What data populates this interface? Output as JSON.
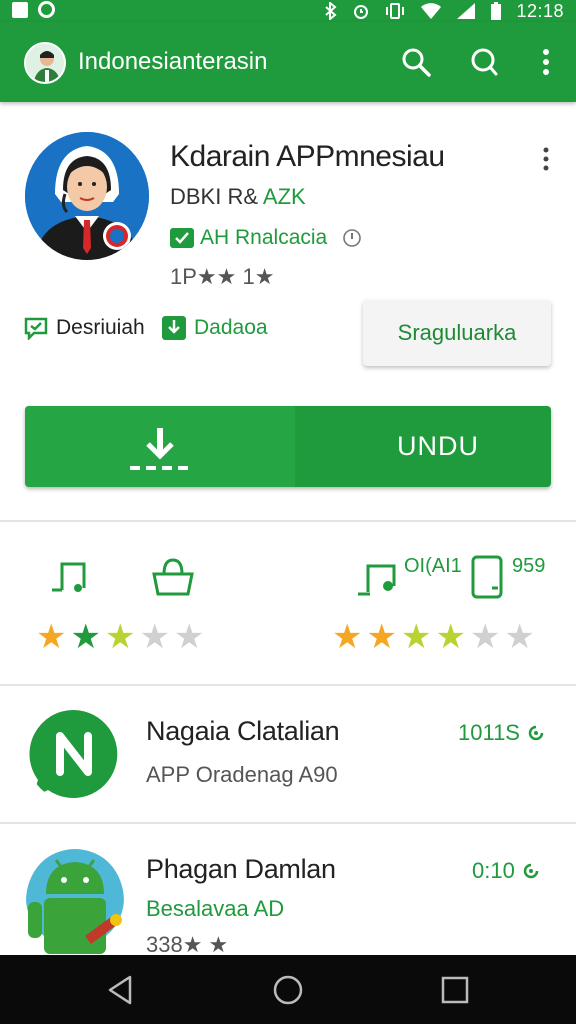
{
  "status_bar": {
    "left_icons": [
      "notification-icon",
      "whatsapp-icon"
    ],
    "right_icons": [
      "bluetooth-icon",
      "alarm-icon",
      "vibrate-icon",
      "wifi-icon",
      "signal-icon",
      "battery-icon"
    ],
    "time": "12:18"
  },
  "app_bar": {
    "title": "Indonesianterasin",
    "icons": [
      "search-icon",
      "chat-search-icon",
      "more-vert-icon"
    ]
  },
  "app": {
    "name": "Kdarain APPmnesiau",
    "developer_prefix": "DBKI R& ",
    "developer_suffix": "AZK",
    "badge": "AH Rnalcacia",
    "rating": "1P★★ 1★"
  },
  "tags": {
    "left": "Desriuiah",
    "right": "Dadaoa"
  },
  "buttons": {
    "secondary": "Sraguluarka",
    "install": "UNDU"
  },
  "stats": {
    "left_icons": [
      "music-note-icon",
      "bag-icon"
    ],
    "right_icons": [
      "music-device-icon",
      "phone-icon"
    ],
    "count_a": "OI(AI1",
    "count_b": "959",
    "left_stars": {
      "filled": 2,
      "half": 1,
      "total": 5
    },
    "right_stars": {
      "filled": 2,
      "half": 2,
      "total": 6
    }
  },
  "list": [
    {
      "title": "Nagaia Clatalian",
      "subtitle": "APP Oradenag A90",
      "size": "1011S"
    },
    {
      "title": "Phagan Damlan",
      "subtitle": "Besalavaa AD",
      "size": "0:10",
      "rating": "338★ ★"
    }
  ],
  "colors": {
    "primary": "#1f9a3c",
    "star": "#f5a623",
    "star_green": "#1f9a3c",
    "star_lime": "#b7d432",
    "star_empty": "#d0d0d0"
  },
  "nav_bar": {
    "icons": [
      "back-icon",
      "home-icon",
      "recents-icon"
    ]
  }
}
